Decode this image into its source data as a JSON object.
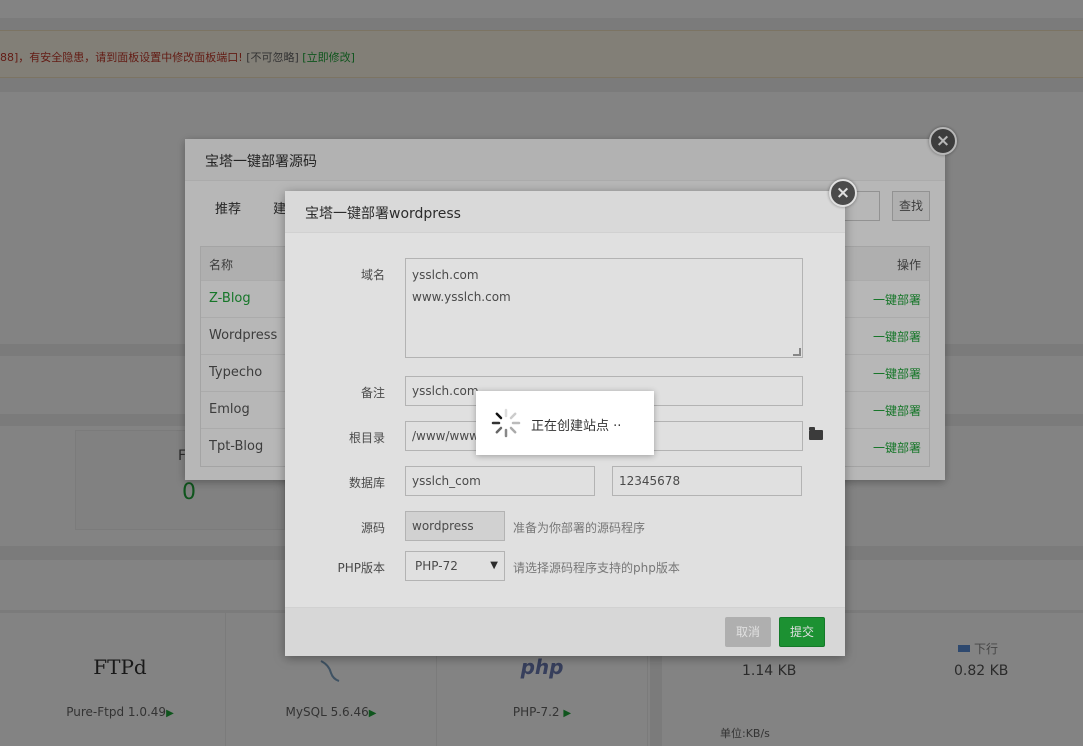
{
  "warning": {
    "text": "88]，有安全隐患，请到面板设置中修改面板端口!",
    "ignore": "[不可忽略]",
    "fix": "[立即修改]"
  },
  "background": {
    "card_label": "F",
    "card_value": "0",
    "software": [
      {
        "logo": "FTPd",
        "name": "Pure-Ftpd 1.0.49"
      },
      {
        "logo": "mysql",
        "name": "MySQL 5.6.46"
      },
      {
        "logo": "php",
        "name": "PHP-7.2"
      }
    ],
    "network": {
      "up_value": "1.14 KB",
      "down_label": "下行",
      "down_value": "0.82 KB",
      "unit": "单位:KB/s"
    }
  },
  "outer_dialog": {
    "title": "宝塔一键部署源码",
    "tabs": [
      "推荐",
      "建"
    ],
    "search_button": "查找",
    "table": {
      "header_name": "名称",
      "header_op": "操作",
      "rows": [
        {
          "name": "Z-Blog",
          "op": "一键部署"
        },
        {
          "name": "Wordpress",
          "op": "一键部署"
        },
        {
          "name": "Typecho",
          "op": "一键部署"
        },
        {
          "name": "Emlog",
          "op": "一键部署"
        },
        {
          "name": "Tpt-Blog",
          "op": "一键部署"
        }
      ]
    }
  },
  "inner_dialog": {
    "title": "宝塔一键部署wordpress",
    "domain": {
      "label": "域名",
      "line1": "ysslch.com",
      "line2": "www.ysslch.com"
    },
    "remark": {
      "label": "备注",
      "value": "ysslch.com"
    },
    "root": {
      "label": "根目录",
      "value": "/www/wwwroot/ysslch.com"
    },
    "database": {
      "label": "数据库",
      "name": "ysslch_com",
      "password": "12345678"
    },
    "source": {
      "label": "源码",
      "value": "wordpress",
      "hint": "准备为你部署的源码程序"
    },
    "php": {
      "label": "PHP版本",
      "value": "PHP-72",
      "hint": "请选择源码程序支持的php版本"
    },
    "cancel": "取消",
    "submit": "提交"
  },
  "loading": {
    "text": "正在创建站点 ··"
  },
  "colors": {
    "accent": "#20a53a",
    "warning": "#c0392b"
  },
  "icons": {
    "close": "close-icon",
    "folder": "folder-icon",
    "spinner": "spinner-icon"
  }
}
